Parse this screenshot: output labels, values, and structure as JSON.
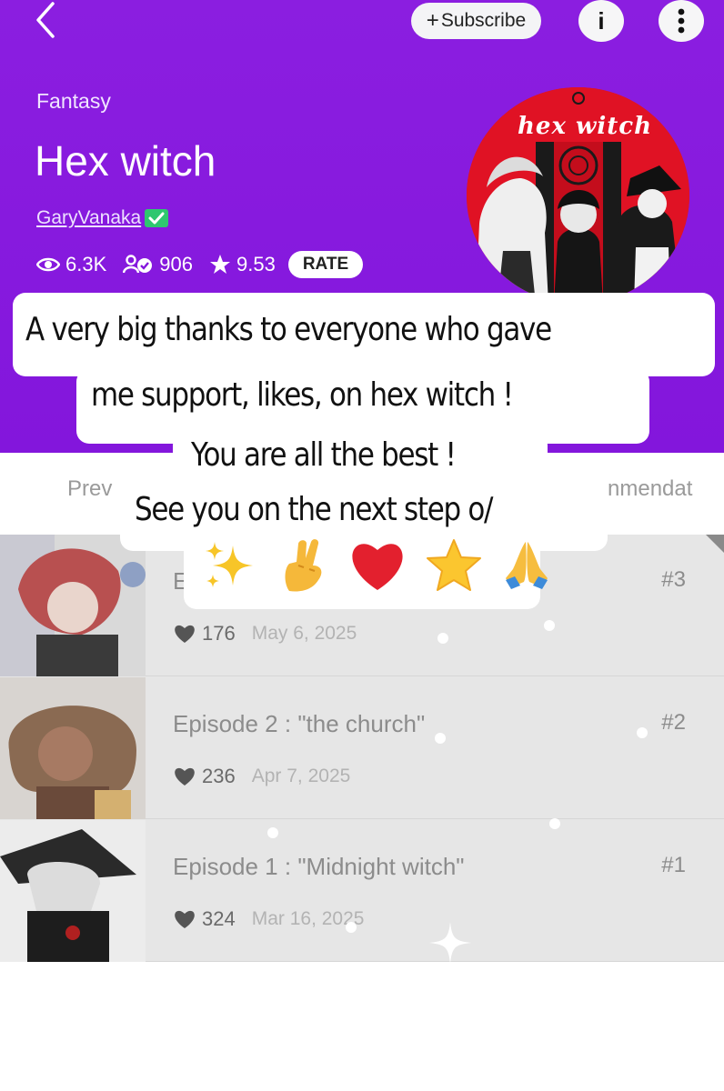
{
  "header": {
    "subscribe_label": "Subscribe",
    "info_label": "i",
    "genre": "Fantasy",
    "title": "Hex witch",
    "author": "GaryVanaka",
    "stats": {
      "views": "6.3K",
      "subscribers": "906",
      "rating": "9.53",
      "rate_label": "RATE"
    },
    "cover_text": "hex witch",
    "accent_color": "#8316dc"
  },
  "tabs": {
    "previous": "Prev",
    "recommendations": "nmendat"
  },
  "episodes": [
    {
      "title": "E",
      "number": "#3",
      "likes": "176",
      "date": "May 6, 2025"
    },
    {
      "title": "Episode 2 : \"the church\"",
      "number": "#2",
      "likes": "236",
      "date": "Apr 7, 2025"
    },
    {
      "title": "Episode 1 : \"Midnight witch\"",
      "number": "#1",
      "likes": "324",
      "date": "Mar 16, 2025"
    }
  ],
  "overlay": {
    "line1": "A very big thanks to everyone who gave",
    "line2": "me support, likes, on hex witch !",
    "line3": "You are all the best !",
    "line4": "See you on the next step o/",
    "emojis": [
      "sparkles-icon",
      "crossed-fingers-icon",
      "red-heart-icon",
      "star-icon",
      "folded-hands-icon"
    ]
  }
}
